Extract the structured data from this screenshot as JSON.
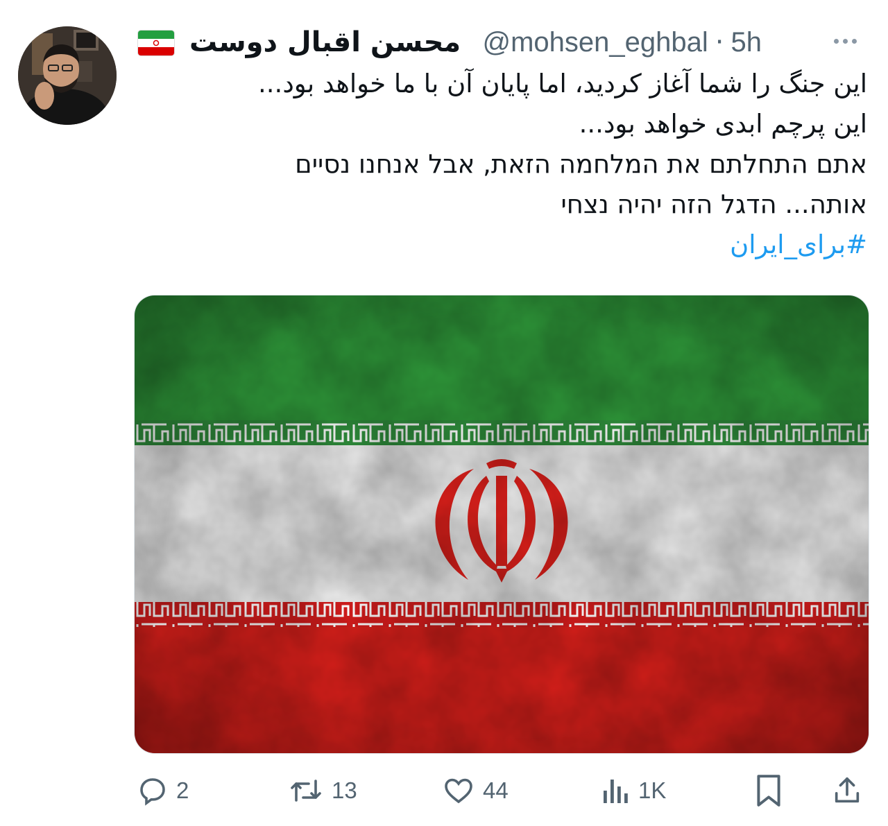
{
  "author": {
    "display_name": "محسن اقبال دوست",
    "handle": "@mohsen_eghbal",
    "separator": "·",
    "time": "5h",
    "flag_emoji": "iran-flag-icon"
  },
  "tweet": {
    "lines": [
      "این جنگ را شما آغاز کردید، اما پایان آن با ما خواهد بود...",
      "این پرچم ابدی خواهد بود...",
      "אתם התחלתם את המלחמה הזאת, אבל אנחנו נסיים",
      "אותה... הדגל הזה יהיה נצחי"
    ],
    "hashtag": "#برای_ایران"
  },
  "media": {
    "description_icon": "iran-flag-image",
    "colors": {
      "green": "#239f40",
      "white": "#f2f2f2",
      "red": "#da0000"
    }
  },
  "actions": {
    "replies": "2",
    "retweets": "13",
    "likes": "44",
    "views": "1K"
  },
  "colors": {
    "accent": "#1d9bf0",
    "secondary_text": "#536471",
    "icon": "#536471"
  }
}
